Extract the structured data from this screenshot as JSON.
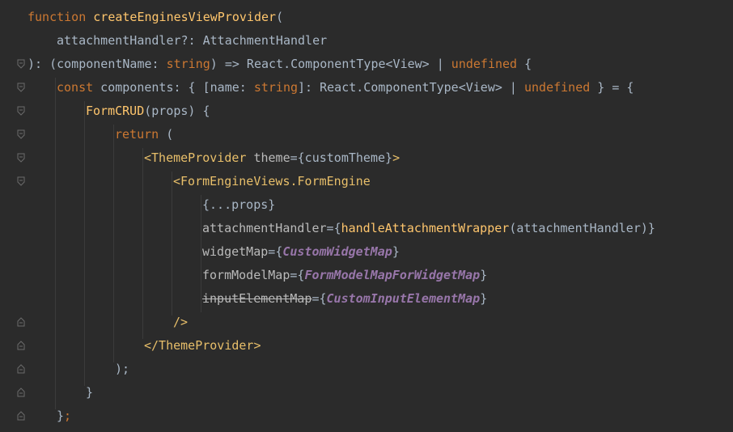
{
  "colors": {
    "background": "#2b2b2b",
    "keyword": "#cc7832",
    "function": "#ffc66d",
    "text": "#a9b7c6",
    "tag": "#e8bf6a",
    "constant": "#9876aa"
  },
  "icons": {
    "fold_open": "fold-open-icon",
    "fold_close": "fold-close-icon"
  },
  "code": {
    "l1": {
      "kw": "function",
      "name": "createEnginesViewProvider",
      "paren": "("
    },
    "l2": {
      "param": "attachmentHandler?",
      "colon": ": ",
      "type": "AttachmentHandler"
    },
    "l3": {
      "a": "): (componentName: ",
      "type1": "string",
      "b": ") => React.ComponentType<View> | ",
      "undef": "undefined",
      "c": " {"
    },
    "l4": {
      "kw": "const",
      "a": " components: { [name: ",
      "type1": "string",
      "b": "]: React.ComponentType<View> | ",
      "undef": "undefined",
      "c": " } = {"
    },
    "l5": {
      "name": "FormCRUD",
      "rest": "(props) {"
    },
    "l6": {
      "kw": "return",
      "rest": " ("
    },
    "l7": {
      "open": "<ThemeProvider",
      "attr": " theme",
      "eq": "=",
      "value": "{customTheme}",
      "close": ">"
    },
    "l8": {
      "open": "<FormEngineViews.FormEngine"
    },
    "l9": {
      "text": "{...props}"
    },
    "l10": {
      "attr": "attachmentHandler",
      "eq": "=",
      "lb": "{",
      "fn": "handleAttachmentWrapper",
      "args": "(attachmentHandler)",
      "rb": "}"
    },
    "l11": {
      "attr": "widgetMap",
      "eq": "=",
      "lb": "{",
      "value": "CustomWidgetMap",
      "rb": "}"
    },
    "l12": {
      "attr": "formModelMap",
      "eq": "=",
      "lb": "{",
      "value": "FormModelMapForWidgetMap",
      "rb": "}"
    },
    "l13": {
      "attr": "inputElementMap",
      "eq": "=",
      "lb": "{",
      "value": "CustomInputElementMap",
      "rb": "}"
    },
    "l14": {
      "text": "/>"
    },
    "l15": {
      "text": "</ThemeProvider>"
    },
    "l16": {
      "text": ");"
    },
    "l17": {
      "text": "}"
    },
    "l18": {
      "text": "}",
      "semi": ";"
    }
  }
}
